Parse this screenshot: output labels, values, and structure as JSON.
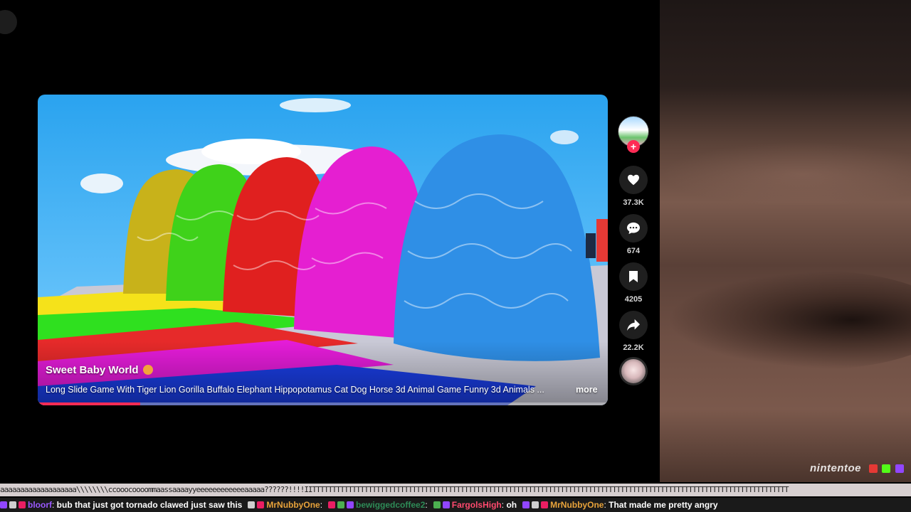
{
  "video": {
    "author": "Sweet Baby World",
    "description": "Long Slide Game With Tiger Lion Gorilla Buffalo Elephant Hippopotamus Cat Dog Horse 3d Animal Game Funny 3d Animals ...",
    "more_label": "more",
    "progress": 0.18
  },
  "actions": {
    "likes": "37.3K",
    "comments": "674",
    "saves": "4205",
    "shares": "22.2K"
  },
  "webcam": {
    "watermark": "nintentoe"
  },
  "ticker": {
    "noise": "aaaaaaaaaaaaaaaaaaa\\\\\\\\\\\\\\\\ccooocoooommaassaaaayyeeeeeeeeeeeeaaaaa??????!!!!IITTTTTTTTTTTTTTTTTTTTTTTTTTTTTTTTTTTTTTTTTTTTTTTTTTTTTTTTTTTTTTTTTTTTTTTTTTTTTTTTTTTTTTTTTTTTTTTTTTTTTTTTTTTTTTTTTTTTTTT"
  },
  "chat": [
    {
      "user": "bloorf",
      "color": "#9b59ff",
      "text": "bub that just got tornado clawed just saw this"
    },
    {
      "user": "MrNubbyOne",
      "color": "#e8a33b",
      "text": ""
    },
    {
      "user": "bewiggedcoffee2",
      "color": "#2e8b57",
      "text": ""
    },
    {
      "user": "FargolsHigh",
      "color": "#ff4a6e",
      "text": "oh"
    },
    {
      "user": "MrNubbyOne",
      "color": "#e8a33b",
      "text": "That made me pretty angry"
    }
  ],
  "colors": {
    "accent": "#fe2c55",
    "rail_button": "#1f1f1f"
  }
}
